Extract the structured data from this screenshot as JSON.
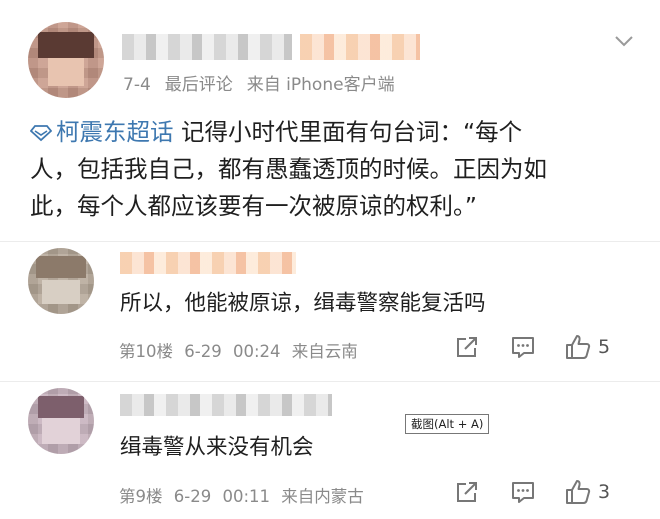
{
  "post": {
    "author_name": "",
    "meta": {
      "date": "7-4",
      "last_comment": "最后评论",
      "source": "来自 iPhone客户端"
    },
    "topic_icon": "diamond-topic-icon",
    "topic": "柯震东超话",
    "line1_rest": " 记得小时代里面有句台词：“每个",
    "line2": "人，包括我自己，都有愚蠢透顶的时候。正因为如",
    "line3": "此，每个人都应该要有一次被原谅的权利。”"
  },
  "comments": [
    {
      "text": "所以，他能被原谅，缉毒警察能复活吗",
      "floor": "第10楼",
      "date": "6-29",
      "time": "00:24",
      "source": "来自云南",
      "likes": "5"
    },
    {
      "text": "缉毒警从来没有机会",
      "floor": "第9楼",
      "date": "6-29",
      "time": "00:11",
      "source": "来自内蒙古",
      "likes": "3"
    }
  ],
  "tooltip": "截图(Alt + A)",
  "colors": {
    "topic_link": "#3e78b0",
    "meta_gray": "#8a8a8a",
    "text": "#1f1f1f"
  },
  "icons": [
    "chevron-down-icon",
    "share-icon",
    "comment-icon",
    "like-icon"
  ]
}
